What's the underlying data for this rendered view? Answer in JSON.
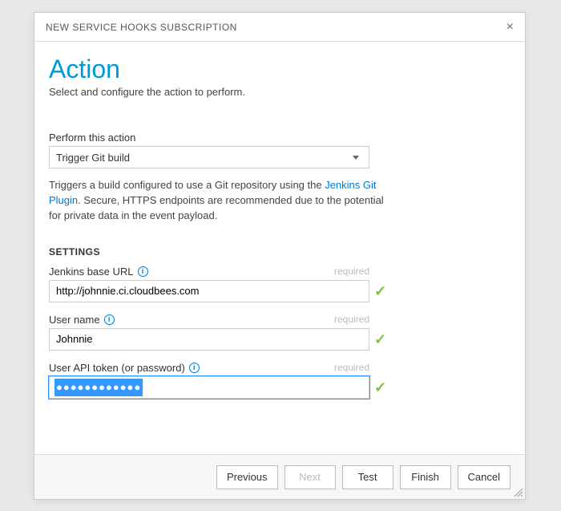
{
  "dialog": {
    "title": "NEW SERVICE HOOKS SUBSCRIPTION"
  },
  "page": {
    "heading": "Action",
    "subtitle": "Select and configure the action to perform."
  },
  "action_field": {
    "label": "Perform this action",
    "selected": "Trigger Git build"
  },
  "help_text": {
    "prefix": "Triggers a build configured to use a Git repository using the ",
    "link": "Jenkins Git Plugin",
    "suffix": ". Secure, HTTPS endpoints are recommended due to the potential for private data in the event payload."
  },
  "settings": {
    "heading": "SETTINGS",
    "required_text": "required",
    "base_url": {
      "label": "Jenkins base URL",
      "value": "http://johnnie.ci.cloudbees.com"
    },
    "user_name": {
      "label": "User name",
      "value": "Johnnie"
    },
    "api_token": {
      "label": "User API token (or password)",
      "masked": "●●●●●●●●●●●●"
    }
  },
  "buttons": {
    "previous": "Previous",
    "next": "Next",
    "test": "Test",
    "finish": "Finish",
    "cancel": "Cancel"
  }
}
